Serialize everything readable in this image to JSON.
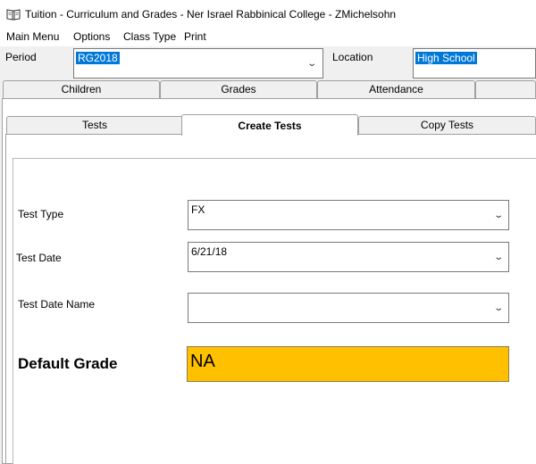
{
  "window": {
    "title": "Tuition - Curriculum and Grades - Ner Israel Rabbinical College - ZMichelsohn",
    "icon": "book-icon"
  },
  "menu": {
    "items": [
      "Main Menu",
      "Options",
      "Class Type",
      "Print"
    ]
  },
  "header": {
    "period_label": "Period",
    "period_value": "RG2018",
    "location_label": "Location",
    "location_value": "High School"
  },
  "outer_tabs": [
    "Children",
    "Grades",
    "Attendance",
    ""
  ],
  "inner_tabs": [
    "Tests",
    "Create Tests",
    "Copy Tests"
  ],
  "form": {
    "test_type_label": "Test Type",
    "test_type_value": "FX",
    "test_date_label": "Test Date",
    "test_date_value": "6/21/18",
    "test_date_name_label": "Test Date Name",
    "test_date_name_value": "",
    "default_grade_label": "Default Grade",
    "default_grade_value": "NA"
  },
  "colors": {
    "selection": "#0078d7",
    "default_grade_bg": "#ffc000",
    "chrome": "#f0f0f0"
  }
}
